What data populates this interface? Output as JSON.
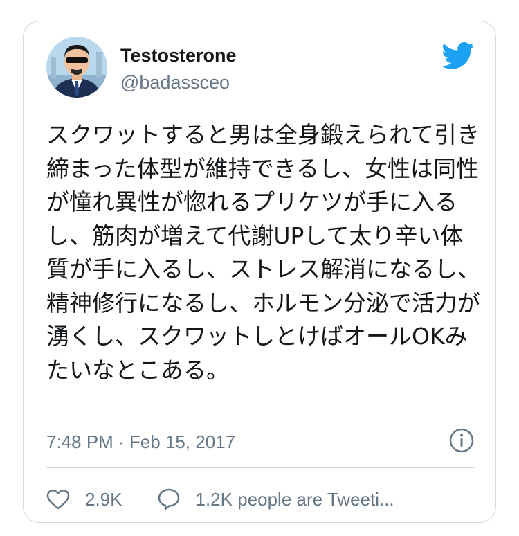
{
  "tweet": {
    "display_name": "Testosterone",
    "handle": "@badassceo",
    "text": "スクワットすると男は全身鍛えられて引き締まった体型が維持できるし、女性は同性が憧れ異性が惚れるプリケツが手に入るし、筋肉が増えて代謝UPして太り辛い体質が手に入るし、ストレス解消になるし、精神修行になるし、ホルモン分泌で活力が湧くし、スクワットしとけばオールOKみたいなとこある。",
    "timestamp": "7:48 PM · Feb 15, 2017"
  },
  "actions": {
    "likes": "2.9K",
    "tweeting": "1.2K people are Tweeti..."
  },
  "icons": {
    "brand": "twitter-bird-icon",
    "info": "info-icon",
    "like": "heart-icon",
    "reply": "speech-bubble-icon"
  },
  "colors": {
    "twitter_blue": "#1da1f2",
    "secondary_text": "#657786",
    "border": "#cfd9de",
    "primary_text": "#14171a"
  }
}
